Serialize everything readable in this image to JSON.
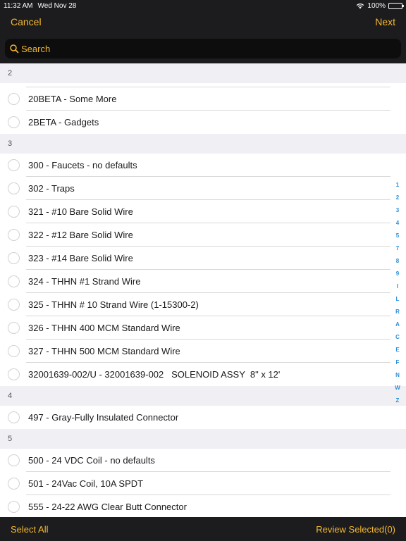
{
  "status": {
    "time": "11:32 AM",
    "date": "Wed Nov 28",
    "battery": "100%"
  },
  "nav": {
    "cancel_label": "Cancel",
    "next_label": "Next"
  },
  "search": {
    "placeholder": "Search"
  },
  "sections": [
    {
      "header": "2",
      "items": [
        "20BETA - Some More",
        "2BETA - Gadgets"
      ]
    },
    {
      "header": "3",
      "items": [
        "300 - Faucets - no defaults",
        "302 - Traps",
        "321 - #10 Bare Solid Wire",
        "322 - #12 Bare Solid Wire",
        "323 - #14 Bare Solid Wire",
        "324 - THHN #1 Strand Wire",
        "325 - THHN # 10 Strand Wire (1-15300-2)",
        "326 - THHN 400 MCM Standard Wire",
        "327 - THHN 500 MCM Standard Wire",
        "32001639-002/U - 32001639-002   SOLENOID ASSY  8\" x 12'"
      ]
    },
    {
      "header": "4",
      "items": [
        "497 - Gray-Fully Insulated Connector"
      ]
    },
    {
      "header": "5",
      "items": [
        "500 - 24 VDC Coil - no defaults",
        "501 - 24Vac Coil, 10A SPDT",
        "555 - 24-22 AWG Clear Butt Connector"
      ]
    }
  ],
  "index": [
    "1",
    "2",
    "3",
    "4",
    "5",
    "7",
    "8",
    "9",
    "I",
    "L",
    "R",
    "A",
    "C",
    "E",
    "F",
    "N",
    "W",
    "Z"
  ],
  "toolbar": {
    "select_all_label": "Select All",
    "review_selected_label": "Review Selected(0)"
  },
  "colors": {
    "accent": "#f5b82e",
    "bar_background": "#1c1c1e",
    "index_blue": "#2f8fd8",
    "battery_green": "#4cd964"
  }
}
